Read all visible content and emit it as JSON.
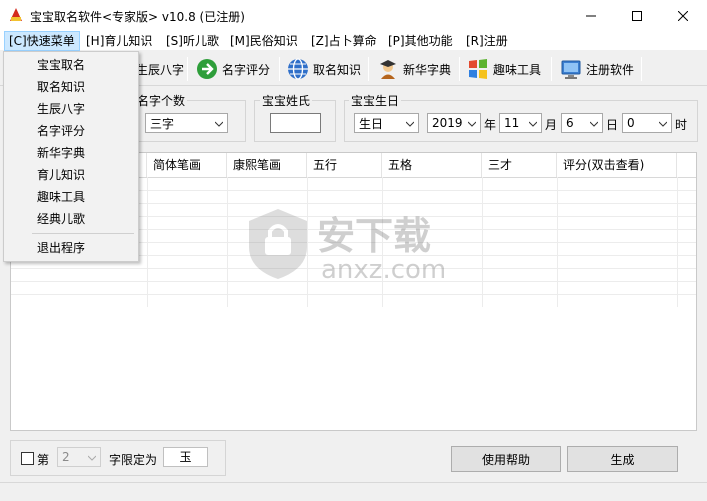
{
  "window": {
    "title": "宝宝取名软件<专家版> v10.8 (已注册)",
    "min_glyph": "—",
    "close_glyph": "✕"
  },
  "menubar": [
    {
      "label": "[C]快速菜单",
      "active": true
    },
    {
      "label": "[H]育儿知识"
    },
    {
      "label": "[S]听儿歌"
    },
    {
      "label": "[M]民俗知识"
    },
    {
      "label": "[Z]占卜算命"
    },
    {
      "label": "[P]其他功能"
    },
    {
      "label": "[R]注册"
    }
  ],
  "toolbar": {
    "partial_label": "生辰八字",
    "name_score": "名字评分",
    "naming_knowledge": "取名知识",
    "xinhua_dict": "新华字典",
    "fun_tools": "趣味工具",
    "register": "注册软件"
  },
  "options": {
    "name_count_label": "名字个数",
    "name_count_value": "三字",
    "surname_label": "宝宝姓氏",
    "surname_value": "",
    "birthday_label": "宝宝生日",
    "calendar_value": "生日",
    "year_value": "2019",
    "year_unit": "年",
    "month_value": "11",
    "month_unit": "月",
    "day_value": "6",
    "day_unit": "日",
    "hour_value": "0",
    "hour_unit": "时"
  },
  "grid": {
    "columns": [
      "简体笔画",
      "康熙笔画",
      "五行",
      "五格",
      "三才",
      "评分(双击查看)"
    ]
  },
  "watermark": {
    "cn": "安下载",
    "en": "anxz.com"
  },
  "bottom": {
    "position_prefix": "第",
    "position_value": "2",
    "limit_label": "字限定为",
    "limit_value": "玉",
    "help_button": "使用帮助",
    "generate_button": "生成"
  },
  "dropdown": {
    "items": [
      "宝宝取名",
      "取名知识",
      "生辰八字",
      "名字评分",
      "新华字典",
      "育儿知识",
      "趣味工具",
      "经典儿歌"
    ],
    "exit": "退出程序"
  },
  "colors": {
    "menu_highlight": "#cce8ff",
    "titlebar": "#ffffff",
    "window": "#f0f0f0"
  }
}
